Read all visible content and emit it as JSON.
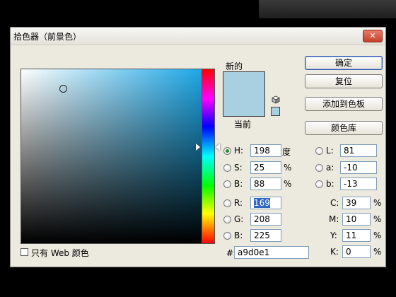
{
  "window": {
    "title": "拾色器（前景色）",
    "close_label": "✕"
  },
  "swatch": {
    "new_label": "新的",
    "current_label": "当前",
    "new_color": "#a9d0e1",
    "current_color": "#a9d0e1"
  },
  "buttons": {
    "ok": "确定",
    "reset": "复位",
    "add_to_swatches": "添加到色板",
    "color_libraries": "颜色库"
  },
  "hsb": {
    "h_label": "H:",
    "h_value": "198",
    "h_unit": "度",
    "s_label": "S:",
    "s_value": "25",
    "s_unit": "%",
    "b_label": "B:",
    "b_value": "88",
    "b_unit": "%",
    "selected": "H"
  },
  "rgb": {
    "r_label": "R:",
    "r_value": "169",
    "g_label": "G:",
    "g_value": "208",
    "b_label": "B:",
    "b_value": "225"
  },
  "lab": {
    "l_label": "L:",
    "l_value": "81",
    "a_label": "a:",
    "a_value": "-10",
    "b_label": "b:",
    "b_value": "-13"
  },
  "cmyk": {
    "c_label": "C:",
    "c_value": "39",
    "m_label": "M:",
    "m_value": "10",
    "y_label": "Y:",
    "y_value": "11",
    "k_label": "K:",
    "k_value": "0",
    "unit": "%"
  },
  "hex": {
    "label": "#",
    "value": "a9d0e1"
  },
  "web_only": {
    "label": "只有 Web 颜色",
    "checked": false
  }
}
